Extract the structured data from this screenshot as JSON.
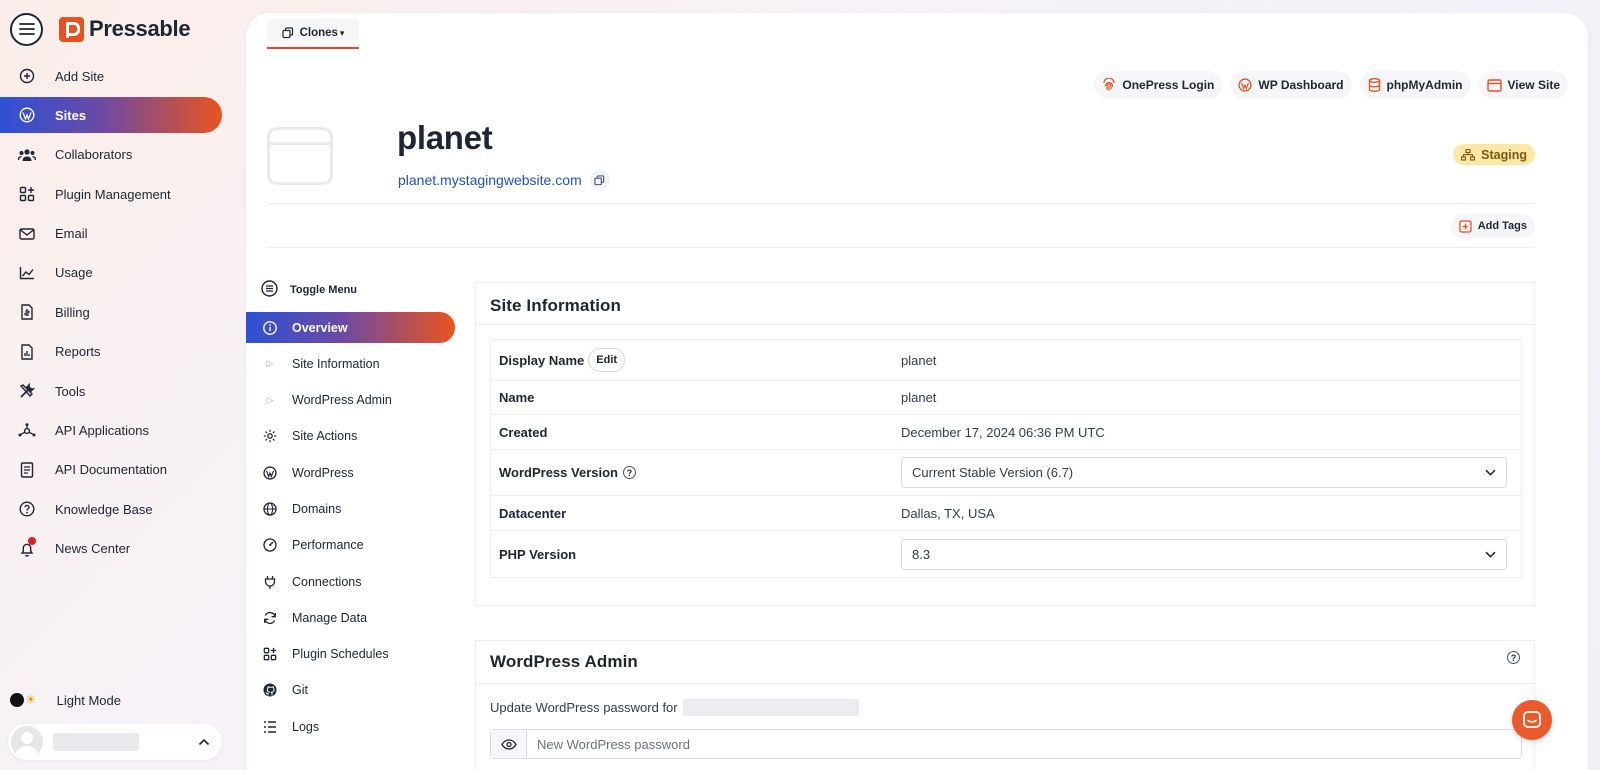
{
  "brand": {
    "name": "Pressable",
    "accent": "#e9501f",
    "link": "#1f4fc9"
  },
  "sidebar": {
    "items": [
      {
        "label": "Add Site",
        "icon": "plus-circle-icon"
      },
      {
        "label": "Sites",
        "icon": "wordpress-icon",
        "active": true
      },
      {
        "label": "Collaborators",
        "icon": "users-icon"
      },
      {
        "label": "Plugin Management",
        "icon": "plugin-grid-icon"
      },
      {
        "label": "Email",
        "icon": "mail-icon"
      },
      {
        "label": "Usage",
        "icon": "chart-line-icon"
      },
      {
        "label": "Billing",
        "icon": "billing-icon"
      },
      {
        "label": "Reports",
        "icon": "report-icon"
      },
      {
        "label": "Tools",
        "icon": "tools-icon"
      },
      {
        "label": "API Applications",
        "icon": "api-icon"
      },
      {
        "label": "API Documentation",
        "icon": "document-icon"
      },
      {
        "label": "Knowledge Base",
        "icon": "question-icon"
      },
      {
        "label": "News Center",
        "icon": "bell-icon"
      }
    ],
    "light_mode_label": "Light Mode"
  },
  "header": {
    "clones_label": "Clones",
    "quick_links": [
      {
        "label": "OnePress Login",
        "icon": "fingerprint-icon"
      },
      {
        "label": "WP Dashboard",
        "icon": "wordpress-icon"
      },
      {
        "label": "phpMyAdmin",
        "icon": "database-icon"
      },
      {
        "label": "View Site",
        "icon": "browser-window-icon"
      }
    ]
  },
  "site": {
    "title": "planet",
    "url": "planet.mystagingwebsite.com",
    "environment_badge": "Staging",
    "add_tags_label": "Add Tags"
  },
  "inner_menu": {
    "toggle_label": "Toggle Menu",
    "items": [
      {
        "label": "Overview",
        "icon": "info-icon",
        "active": true
      },
      {
        "label": "Site Information",
        "icon": "triangle-right-icon",
        "sub": true
      },
      {
        "label": "WordPress Admin",
        "icon": "triangle-right-icon",
        "sub": true
      },
      {
        "label": "Site Actions",
        "icon": "gear-icon"
      },
      {
        "label": "WordPress",
        "icon": "wordpress-icon"
      },
      {
        "label": "Domains",
        "icon": "globe-icon"
      },
      {
        "label": "Performance",
        "icon": "gauge-icon"
      },
      {
        "label": "Connections",
        "icon": "plug-icon"
      },
      {
        "label": "Manage Data",
        "icon": "refresh-icon"
      },
      {
        "label": "Plugin Schedules",
        "icon": "plugin-grid-icon"
      },
      {
        "label": "Git",
        "icon": "github-icon"
      },
      {
        "label": "Logs",
        "icon": "list-icon"
      }
    ]
  },
  "site_information": {
    "title": "Site Information",
    "edit_label": "Edit",
    "rows": [
      {
        "label": "Display Name",
        "value": "planet"
      },
      {
        "label": "Name",
        "value": "planet"
      },
      {
        "label": "Created",
        "value": "December 17, 2024 06:36 PM UTC"
      },
      {
        "label": "WordPress Version",
        "value": "Current Stable Version (6.7)"
      },
      {
        "label": "Datacenter",
        "value": "Dallas, TX, USA"
      },
      {
        "label": "PHP Version",
        "value": "8.3"
      }
    ]
  },
  "wordpress_admin": {
    "title": "WordPress Admin",
    "update_text": "Update WordPress password for",
    "password_placeholder": "New WordPress password"
  }
}
